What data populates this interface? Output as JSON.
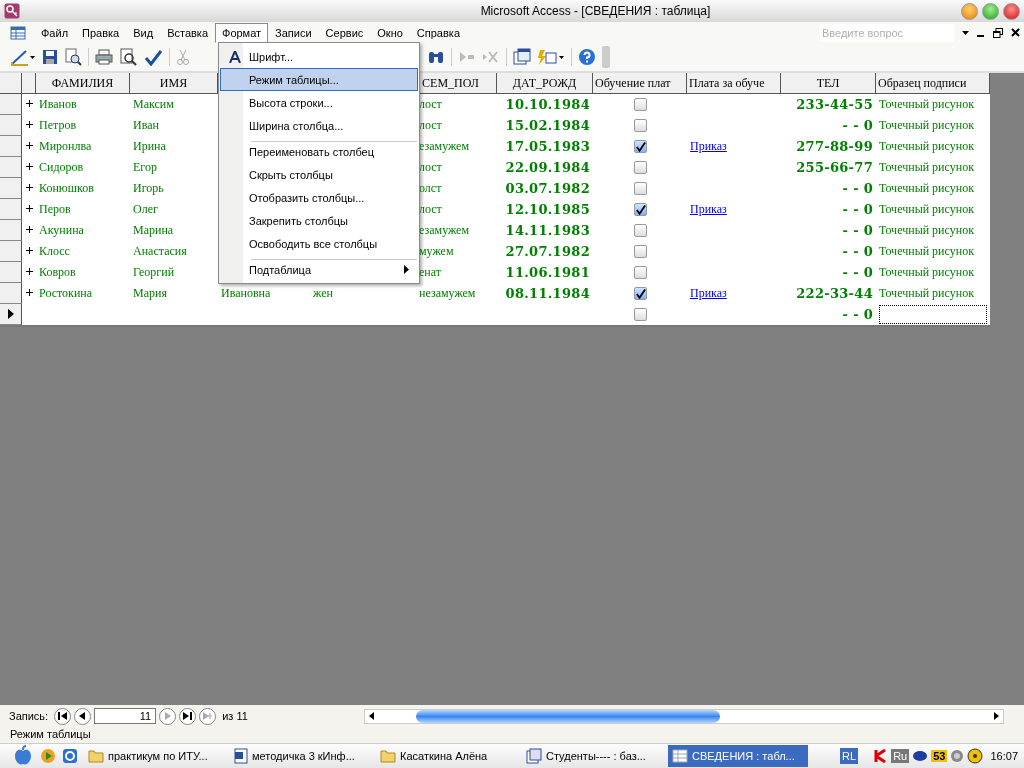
{
  "window": {
    "title": "Microsoft Access - [СВЕДЕНИЯ : таблица]"
  },
  "menubar": {
    "items": [
      {
        "label": "Файл",
        "selected": false
      },
      {
        "label": "Правка",
        "selected": false
      },
      {
        "label": "Вид",
        "selected": false
      },
      {
        "label": "Вставка",
        "selected": false
      },
      {
        "label": "Формат",
        "selected": true
      },
      {
        "label": "Записи",
        "selected": false
      },
      {
        "label": "Сервис",
        "selected": false
      },
      {
        "label": "Окно",
        "selected": false
      },
      {
        "label": "Справка",
        "selected": false
      }
    ]
  },
  "help_search": {
    "placeholder": "Введите вопрос"
  },
  "format_menu": {
    "items": [
      {
        "label": "Шрифт...",
        "kind": "font",
        "selected": false,
        "separator_before": false
      },
      {
        "label": "Режим таблицы...",
        "kind": "item",
        "selected": true,
        "separator_before": false
      },
      {
        "label": "Высота строки...",
        "kind": "item",
        "selected": false,
        "separator_before": false
      },
      {
        "label": "Ширина столбца...",
        "kind": "item",
        "selected": false,
        "separator_before": false
      },
      {
        "label": "Переименовать столбец",
        "kind": "item",
        "selected": false,
        "separator_before": true
      },
      {
        "label": "Скрыть столбцы",
        "kind": "item",
        "selected": false,
        "separator_before": false
      },
      {
        "label": "Отобразить столбцы...",
        "kind": "item",
        "selected": false,
        "separator_before": false
      },
      {
        "label": "Закрепить столбцы",
        "kind": "item",
        "selected": false,
        "separator_before": false
      },
      {
        "label": "Освободить все столбцы",
        "kind": "item",
        "selected": false,
        "separator_before": false
      },
      {
        "label": "Подтаблица",
        "kind": "submenu",
        "selected": false,
        "separator_before": true
      }
    ]
  },
  "table": {
    "columns": {
      "surname": "ФАМИЛИЯ",
      "name": "ИМЯ",
      "marital": "СЕМ_ПОЛ",
      "birth_date": "ДАТ_РОЖД",
      "paid": "Обучение плат",
      "payment": "Плата за обуче",
      "phone": "ТЕЛ",
      "signature": "Образец подписи"
    },
    "rows": [
      {
        "kind": "record",
        "current": false,
        "surname": "Иванов",
        "name": "Максим",
        "marital": "лост",
        "birth_date": "10.10.1984",
        "paid": false,
        "phone": "233-44-55",
        "signature": "Точечный рисунок"
      },
      {
        "kind": "record",
        "current": false,
        "surname": "Петров",
        "name": "Иван",
        "marital": "лост",
        "birth_date": "15.02.1984",
        "paid": false,
        "phone": "- - 0",
        "signature": "Точечный рисунок"
      },
      {
        "kind": "record",
        "current": false,
        "surname": "Миронлва",
        "name": "Ирина",
        "marital": "езамужем",
        "birth_date": "17.05.1983",
        "paid": true,
        "payment": "Приказ",
        "phone": "277-88-99",
        "signature": "Точечный рисунок"
      },
      {
        "kind": "record",
        "current": false,
        "surname": "Сидоров",
        "name": "Егор",
        "marital": "лост",
        "birth_date": "22.09.1984",
        "paid": false,
        "phone": "255-66-77",
        "signature": "Точечный рисунок"
      },
      {
        "kind": "record",
        "current": false,
        "surname": "Конюшков",
        "name": "Игорь",
        "marital": "олст",
        "birth_date": "03.07.1982",
        "paid": false,
        "phone": "- - 0",
        "signature": "Точечный рисунок"
      },
      {
        "kind": "record",
        "current": false,
        "surname": "Перов",
        "name": "Олег",
        "marital": "лост",
        "birth_date": "12.10.1985",
        "paid": true,
        "payment": "Приказ",
        "phone": "- - 0",
        "signature": "Точечный рисунок"
      },
      {
        "kind": "record",
        "current": false,
        "surname": "Акунина",
        "name": "Марина",
        "marital": "езамужем",
        "birth_date": "14.11.1983",
        "paid": false,
        "phone": "- - 0",
        "signature": "Точечный рисунок"
      },
      {
        "kind": "record",
        "current": false,
        "surname": "Клосс",
        "name": "Анастасия",
        "marital": "мужем",
        "birth_date": "27.07.1982",
        "paid": false,
        "phone": "- - 0",
        "signature": "Точечный рисунок"
      },
      {
        "kind": "record",
        "current": false,
        "surname": "Ковров",
        "name": "Георгий",
        "marital": "енат",
        "birth_date": "11.06.1981",
        "paid": false,
        "phone": "- - 0",
        "signature": "Точечный рисунок"
      },
      {
        "kind": "record",
        "current": false,
        "surname": "Ростокина",
        "name": "Мария",
        "column_3": "Ивановна",
        "column_4": "жен",
        "marital": "незамужем",
        "birth_date": "08.11.1984",
        "paid": true,
        "payment": "Приказ",
        "phone": "222-33-44",
        "signature": "Точечный рисунок"
      },
      {
        "kind": "new",
        "current": true,
        "paid": false,
        "phone": "- - 0"
      }
    ]
  },
  "navigator": {
    "label": "Запись:",
    "record": "11",
    "total": "из 11"
  },
  "status_bar": {
    "text": "Режим таблицы"
  },
  "taskbar": {
    "items": [
      {
        "label": "практикум по ИТУ...",
        "kind": "folder",
        "selected": false
      },
      {
        "label": "методичка 3 кИнф...",
        "kind": "word",
        "selected": false
      },
      {
        "label": "Касаткина Алёна",
        "kind": "folder",
        "selected": false
      },
      {
        "label": "Студенты---- : баз...",
        "kind": "db",
        "selected": false
      },
      {
        "label": "СВЕДЕНИЯ : табл...",
        "kind": "table",
        "selected": true
      }
    ],
    "language": "RL",
    "tray_language": "Ru",
    "tray_number": "53",
    "clock": "16:07"
  }
}
